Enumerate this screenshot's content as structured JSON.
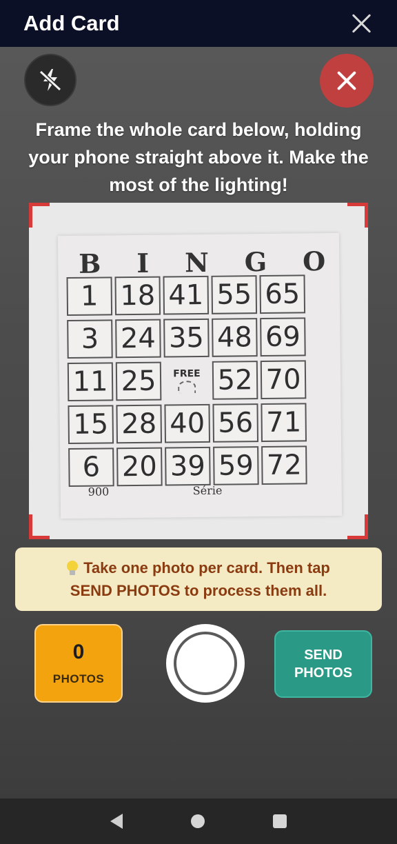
{
  "header": {
    "title": "Add Card",
    "close_icon": "close-icon"
  },
  "camera": {
    "flash_icon": "flash-off-icon",
    "cancel_icon": "close-icon",
    "cancel_color": "#c0403f",
    "instructions": "Frame the whole card below, holding your phone straight above it. Make the most of the lighting!"
  },
  "bingo_card": {
    "letters": [
      "B",
      "I",
      "N",
      "G",
      "O"
    ],
    "rows": [
      [
        "1",
        "18",
        "41",
        "55",
        "65"
      ],
      [
        "3",
        "24",
        "35",
        "48",
        "69"
      ],
      [
        "11",
        "25",
        "FREE",
        "52",
        "70"
      ],
      [
        "15",
        "28",
        "40",
        "56",
        "71"
      ],
      [
        "6",
        "20",
        "39",
        "59",
        "72"
      ]
    ],
    "card_number": "900",
    "series_label": "Série"
  },
  "tip": {
    "icon": "lightbulb-icon",
    "line1": "Take one photo per card. Then tap",
    "line2": "SEND PHOTOS to process them all.",
    "background": "#f4eac4",
    "text_color": "#8a3b10"
  },
  "controls": {
    "photo_count": "0",
    "photo_count_label": "PHOTOS",
    "count_color": "#f3a30e",
    "send_line1": "SEND",
    "send_line2": "PHOTOS",
    "send_color": "#2a9a86"
  },
  "navbar": {
    "back_icon": "back-icon",
    "home_icon": "home-icon",
    "recents_icon": "recents-icon"
  }
}
